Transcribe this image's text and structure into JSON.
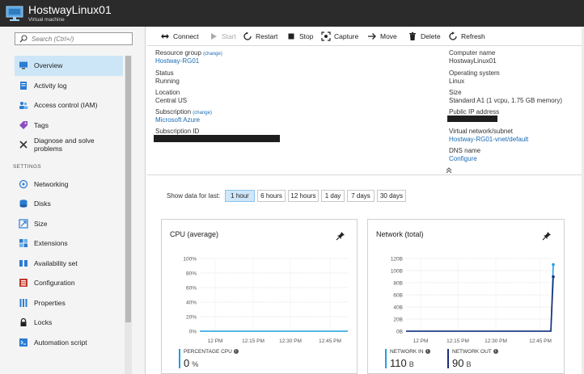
{
  "header": {
    "title": "HostwayLinux01",
    "subtitle": "Virtual machine",
    "icon": "virtual-machine-icon"
  },
  "sidebar": {
    "search_placeholder": "Search (Ctrl+/)",
    "items": [
      {
        "label": "Overview",
        "icon": "monitor-icon",
        "active": true
      },
      {
        "label": "Activity log",
        "icon": "activity-log-icon"
      },
      {
        "label": "Access control (IAM)",
        "icon": "users-icon"
      },
      {
        "label": "Tags",
        "icon": "tag-icon"
      },
      {
        "label": "Diagnose and solve problems",
        "icon": "wrench-icon"
      }
    ],
    "section_settings": "SETTINGS",
    "settings_items": [
      {
        "label": "Networking",
        "icon": "network-icon"
      },
      {
        "label": "Disks",
        "icon": "disks-icon"
      },
      {
        "label": "Size",
        "icon": "size-icon"
      },
      {
        "label": "Extensions",
        "icon": "extensions-icon"
      },
      {
        "label": "Availability set",
        "icon": "availability-set-icon"
      },
      {
        "label": "Configuration",
        "icon": "configuration-icon"
      },
      {
        "label": "Properties",
        "icon": "properties-icon"
      },
      {
        "label": "Locks",
        "icon": "lock-icon"
      },
      {
        "label": "Automation script",
        "icon": "automation-script-icon"
      }
    ]
  },
  "toolbar": {
    "connect": "Connect",
    "start": "Start",
    "restart": "Restart",
    "stop": "Stop",
    "capture": "Capture",
    "move": "Move",
    "delete": "Delete",
    "refresh": "Refresh"
  },
  "essentials": {
    "left": {
      "resource_group_label": "Resource group",
      "resource_group_change": "(change)",
      "resource_group_value": "Hostway-RG01",
      "status_label": "Status",
      "status_value": "Running",
      "location_label": "Location",
      "location_value": "Central US",
      "subscription_label": "Subscription",
      "subscription_change": "(change)",
      "subscription_value": "Microsoft Azure",
      "subscription_id_label": "Subscription ID"
    },
    "right": {
      "computer_name_label": "Computer name",
      "computer_name_value": "HostwayLinux01",
      "os_label": "Operating system",
      "os_value": "Linux",
      "size_label": "Size",
      "size_value": "Standard A1 (1 vcpu, 1.75 GB memory)",
      "public_ip_label": "Public IP address",
      "vnet_label": "Virtual network/subnet",
      "vnet_value": "Hostway-RG01-vnet/default",
      "dns_label": "DNS name",
      "dns_value": "Configure"
    }
  },
  "timerange": {
    "label": "Show data for last:",
    "options": [
      "1 hour",
      "6 hours",
      "12 hours",
      "1 day",
      "7 days",
      "30 days"
    ],
    "selected": "1 hour"
  },
  "chart_data": [
    {
      "type": "line",
      "title": "CPU (average)",
      "y_ticks": [
        "100%",
        "80%",
        "60%",
        "40%",
        "20%",
        "0%"
      ],
      "ylim": [
        0,
        100
      ],
      "x_ticks": [
        "12 PM",
        "12:15 PM",
        "12:30 PM",
        "12:45 PM"
      ],
      "series": [
        {
          "name": "PERCENTAGE CPU",
          "color": "#1ba1e2",
          "values": [
            0,
            0,
            0,
            0,
            0,
            0,
            0,
            0,
            0,
            0,
            0,
            0,
            0,
            0,
            0,
            0,
            0,
            0,
            0,
            0,
            0,
            0,
            0,
            0,
            0,
            0,
            0,
            0,
            0,
            0,
            0,
            0,
            0,
            0,
            0,
            0,
            0,
            0,
            0,
            0,
            0,
            0,
            0,
            0,
            0,
            0,
            0,
            0,
            0,
            0,
            0,
            0,
            0,
            0,
            0,
            0,
            0,
            0,
            0,
            0,
            0
          ]
        }
      ],
      "legend": [
        {
          "name": "PERCENTAGE CPU",
          "value": "0",
          "unit": "%",
          "color": "#1ba1e2"
        }
      ]
    },
    {
      "type": "line",
      "title": "Network (total)",
      "y_ticks": [
        "120B",
        "100B",
        "80B",
        "60B",
        "40B",
        "20B",
        "0B"
      ],
      "ylim": [
        0,
        120
      ],
      "x_ticks": [
        "12 PM",
        "12:15 PM",
        "12:30 PM",
        "12:45 PM"
      ],
      "series": [
        {
          "name": "NETWORK IN",
          "color": "#1ba1e2",
          "values": [
            0,
            0,
            0,
            0,
            0,
            0,
            0,
            0,
            0,
            0,
            0,
            0,
            0,
            0,
            0,
            0,
            0,
            0,
            0,
            0,
            0,
            0,
            0,
            0,
            0,
            0,
            0,
            0,
            0,
            0,
            0,
            0,
            0,
            0,
            0,
            0,
            0,
            0,
            0,
            0,
            0,
            0,
            0,
            0,
            0,
            0,
            0,
            0,
            0,
            0,
            0,
            0,
            0,
            0,
            0,
            0,
            0,
            0,
            0,
            0,
            110
          ]
        },
        {
          "name": "NETWORK OUT",
          "color": "#1f2d7a",
          "values": [
            0,
            0,
            0,
            0,
            0,
            0,
            0,
            0,
            0,
            0,
            0,
            0,
            0,
            0,
            0,
            0,
            0,
            0,
            0,
            0,
            0,
            0,
            0,
            0,
            0,
            0,
            0,
            0,
            0,
            0,
            0,
            0,
            0,
            0,
            0,
            0,
            0,
            0,
            0,
            0,
            0,
            0,
            0,
            0,
            0,
            0,
            0,
            0,
            0,
            0,
            0,
            0,
            0,
            0,
            0,
            0,
            0,
            0,
            0,
            0,
            90
          ]
        }
      ],
      "legend": [
        {
          "name": "NETWORK IN",
          "value": "110",
          "unit": "B",
          "color": "#1ba1e2"
        },
        {
          "name": "NETWORK OUT",
          "value": "90",
          "unit": "B",
          "color": "#1f2d7a"
        }
      ]
    }
  ]
}
